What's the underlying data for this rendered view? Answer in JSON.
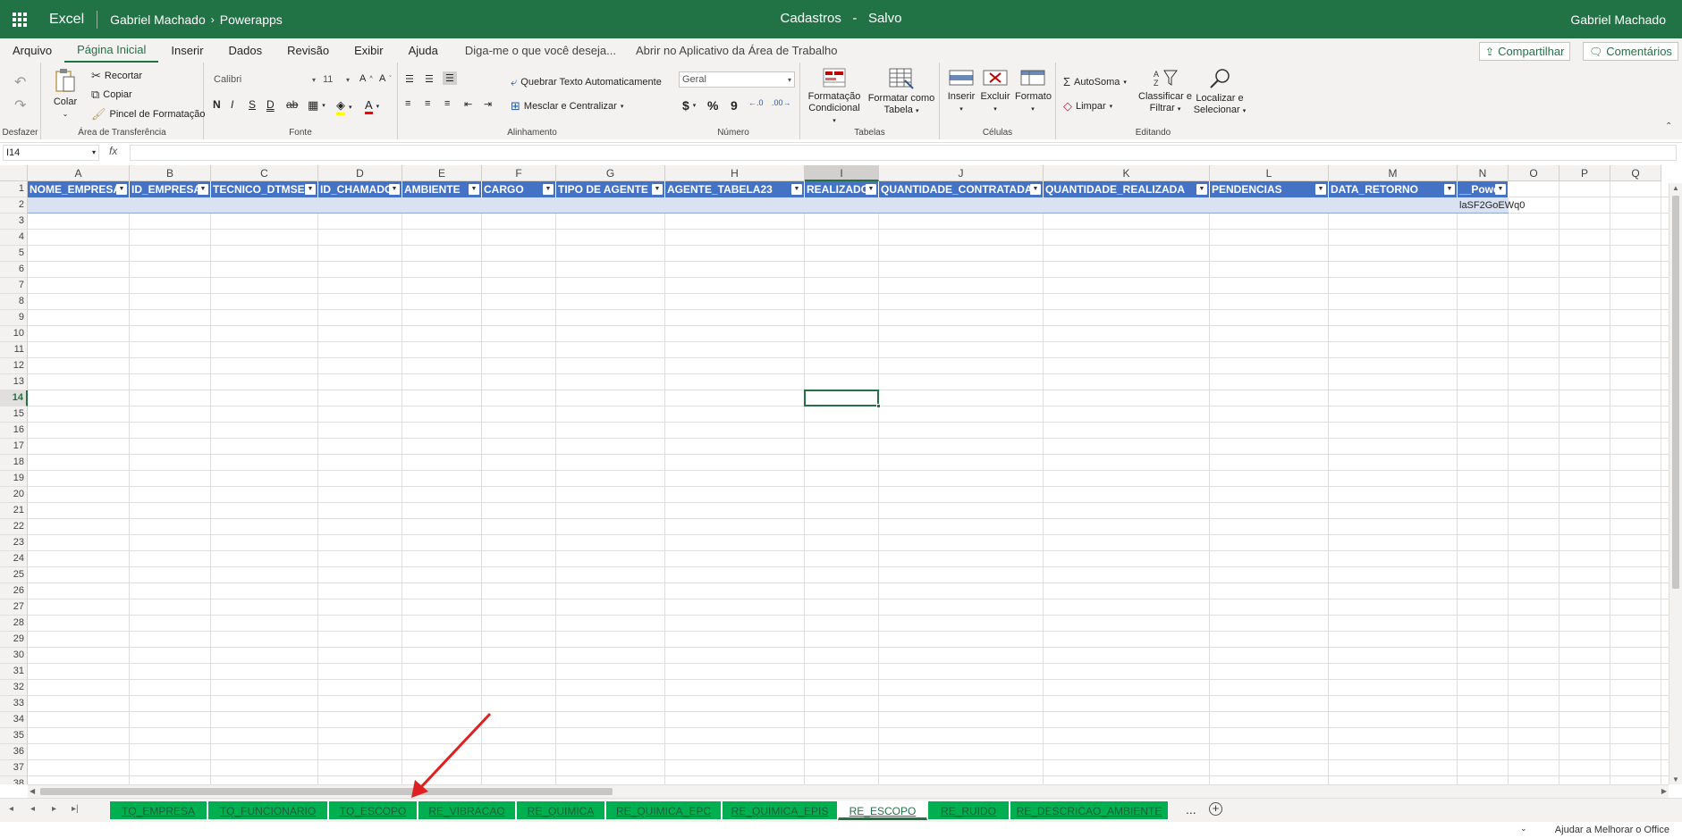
{
  "titlebar": {
    "app": "Excel",
    "user_crumb": "Gabriel Machado",
    "folder_crumb": "Powerapps",
    "doc_title": "Cadastros",
    "separator": "-",
    "save_status": "Salvo",
    "user_name": "Gabriel Machado"
  },
  "menu": {
    "tabs": [
      "Arquivo",
      "Página Inicial",
      "Inserir",
      "Dados",
      "Revisão",
      "Exibir",
      "Ajuda"
    ],
    "active": "Página Inicial",
    "tell_me": "Diga-me o que você deseja...",
    "open_desktop": "Abrir no Aplicativo da Área de Trabalho",
    "share": "Compartilhar",
    "comments": "Comentários"
  },
  "ribbon": {
    "undo_group": "Desfazer",
    "clipboard": {
      "label": "Área de Transferência",
      "paste": "Colar",
      "cut": "Recortar",
      "copy": "Copiar",
      "format_painter": "Pincel de Formatação"
    },
    "font": {
      "label": "Fonte",
      "name": "Calibri",
      "size": "11",
      "bold": "N",
      "italic": "I",
      "underline": "S",
      "double_underline": "D",
      "strike": "ab"
    },
    "alignment": {
      "label": "Alinhamento",
      "wrap": "Quebrar Texto Automaticamente",
      "merge": "Mesclar e Centralizar"
    },
    "number": {
      "label": "Número",
      "format": "Geral",
      "currency": "$",
      "percent": "%",
      "comma": "9"
    },
    "tables": {
      "label": "Tabelas",
      "cond_format_1": "Formatação",
      "cond_format_2": "Condicional",
      "format_table_1": "Formatar como",
      "format_table_2": "Tabela"
    },
    "cells": {
      "label": "Células",
      "insert": "Inserir",
      "delete": "Excluir",
      "format": "Formato"
    },
    "editing": {
      "label": "Editando",
      "autosum": "AutoSoma",
      "clear": "Limpar",
      "sort_1": "Classificar e",
      "sort_2": "Filtrar",
      "find_1": "Localizar e",
      "find_2": "Selecionar"
    }
  },
  "formula_bar": {
    "name_box": "I14",
    "fx": "fx",
    "value": ""
  },
  "grid": {
    "columns": [
      "A",
      "B",
      "C",
      "D",
      "E",
      "F",
      "G",
      "H",
      "I",
      "J",
      "K",
      "L",
      "M",
      "N",
      "O",
      "P",
      "Q"
    ],
    "selected_column": "I",
    "rows": [
      "1",
      "2",
      "3",
      "4",
      "5",
      "6",
      "7",
      "8",
      "9",
      "10",
      "11",
      "12",
      "13",
      "14",
      "15",
      "16",
      "17",
      "18",
      "19",
      "20",
      "21",
      "22",
      "23",
      "24",
      "25",
      "26",
      "27",
      "28",
      "29",
      "30",
      "31",
      "32",
      "33",
      "34",
      "35",
      "36",
      "37",
      "38"
    ],
    "selected_row": "14",
    "table_headers": [
      "NOME_EMPRESA",
      "ID_EMPRESA",
      "TECNICO_DTMSEG",
      "ID_CHAMADO",
      "AMBIENTE",
      "CARGO",
      "TIPO DE AGENTE",
      "AGENTE_TABELA23",
      "REALIZADO",
      "QUANTIDADE_CONTRATADA",
      "QUANTIDADE_REALIZADA",
      "PENDENCIAS",
      "DATA_RETORNO",
      "__Powe"
    ],
    "n2_value": "laSF2GoEWq0"
  },
  "sheets": {
    "tabs": [
      "TQ_EMPRESA",
      "TQ_FUNCIONARIO",
      "TQ_ESCOPO",
      "RE_VIBRACAO",
      "RE_QUIMICA",
      "RE_QUIMICA_EPC",
      "RE_QUIMICA_EPIS",
      "RE_ESCOPO",
      "RE_RUIDO",
      "RE_DESCRICAO_AMBIENTE"
    ],
    "active": "RE_ESCOPO",
    "more": "...",
    "add": "+"
  },
  "status": {
    "help_improve": "Ajudar a Melhorar o Office"
  },
  "colors": {
    "accent": "#217346",
    "table_header": "#4472c4",
    "sheet_tab": "#00b050",
    "annotation_arrow": "#e02020"
  }
}
